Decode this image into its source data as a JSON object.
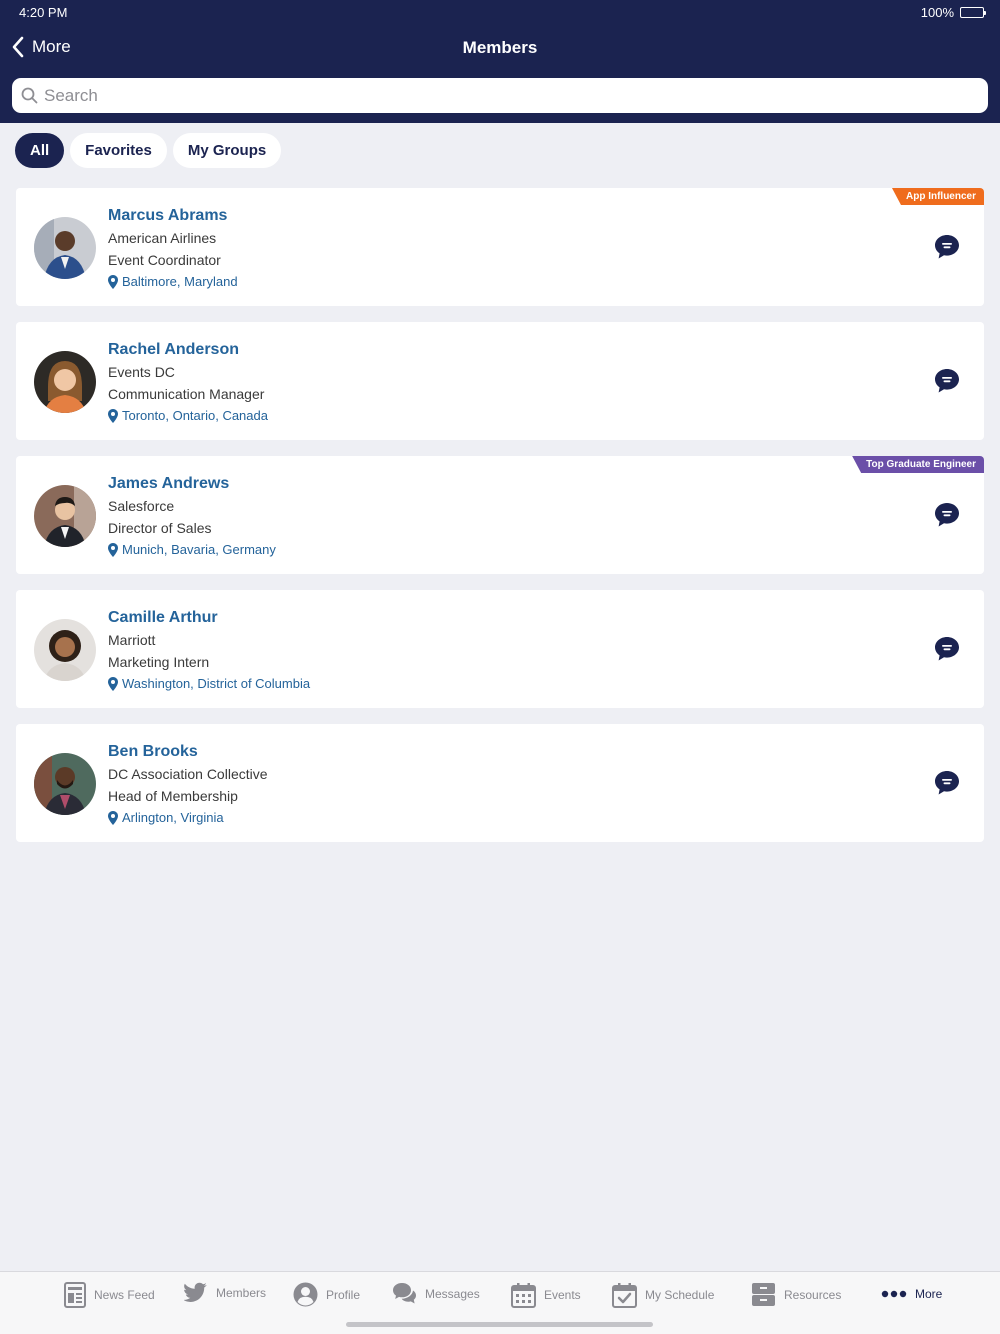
{
  "status": {
    "time": "4:20 PM",
    "battery": "100%"
  },
  "header": {
    "back_label": "More",
    "title": "Members"
  },
  "search": {
    "placeholder": "Search"
  },
  "filters": [
    {
      "label": "All",
      "active": true
    },
    {
      "label": "Favorites",
      "active": false
    },
    {
      "label": "My Groups",
      "active": false
    }
  ],
  "members": [
    {
      "name": "Marcus Abrams",
      "company": "American Airlines",
      "role": "Event Coordinator",
      "location": "Baltimore, Maryland",
      "badge": {
        "label": "App Influencer",
        "color": "#ef6c1d"
      }
    },
    {
      "name": "Rachel Anderson",
      "company": "Events DC",
      "role": "Communication Manager",
      "location": "Toronto, Ontario, Canada"
    },
    {
      "name": "James Andrews",
      "company": "Salesforce",
      "role": "Director of Sales",
      "location": "Munich, Bavaria, Germany",
      "badge": {
        "label": "Top Graduate Engineer",
        "color": "#6b4fa8"
      }
    },
    {
      "name": "Camille Arthur",
      "company": "Marriott",
      "role": "Marketing Intern",
      "location": "Washington, District of Columbia"
    },
    {
      "name": "Ben Brooks",
      "company": "DC Association Collective",
      "role": "Head of Membership",
      "location": "Arlington, Virginia"
    }
  ],
  "tabbar": [
    {
      "label": "News Feed",
      "icon": "news-feed-icon"
    },
    {
      "label": "Members",
      "icon": "bird-icon"
    },
    {
      "label": "Profile",
      "icon": "profile-icon"
    },
    {
      "label": "Messages",
      "icon": "chat-bubbles-icon"
    },
    {
      "label": "Events",
      "icon": "calendar-icon"
    },
    {
      "label": "My Schedule",
      "icon": "calendar-check-icon"
    },
    {
      "label": "Resources",
      "icon": "archive-icon"
    },
    {
      "label": "More",
      "icon": "more-dots-icon",
      "active": true
    }
  ],
  "colors": {
    "navy": "#1b2350",
    "link_blue": "#24639a",
    "background": "#eeeff4"
  }
}
